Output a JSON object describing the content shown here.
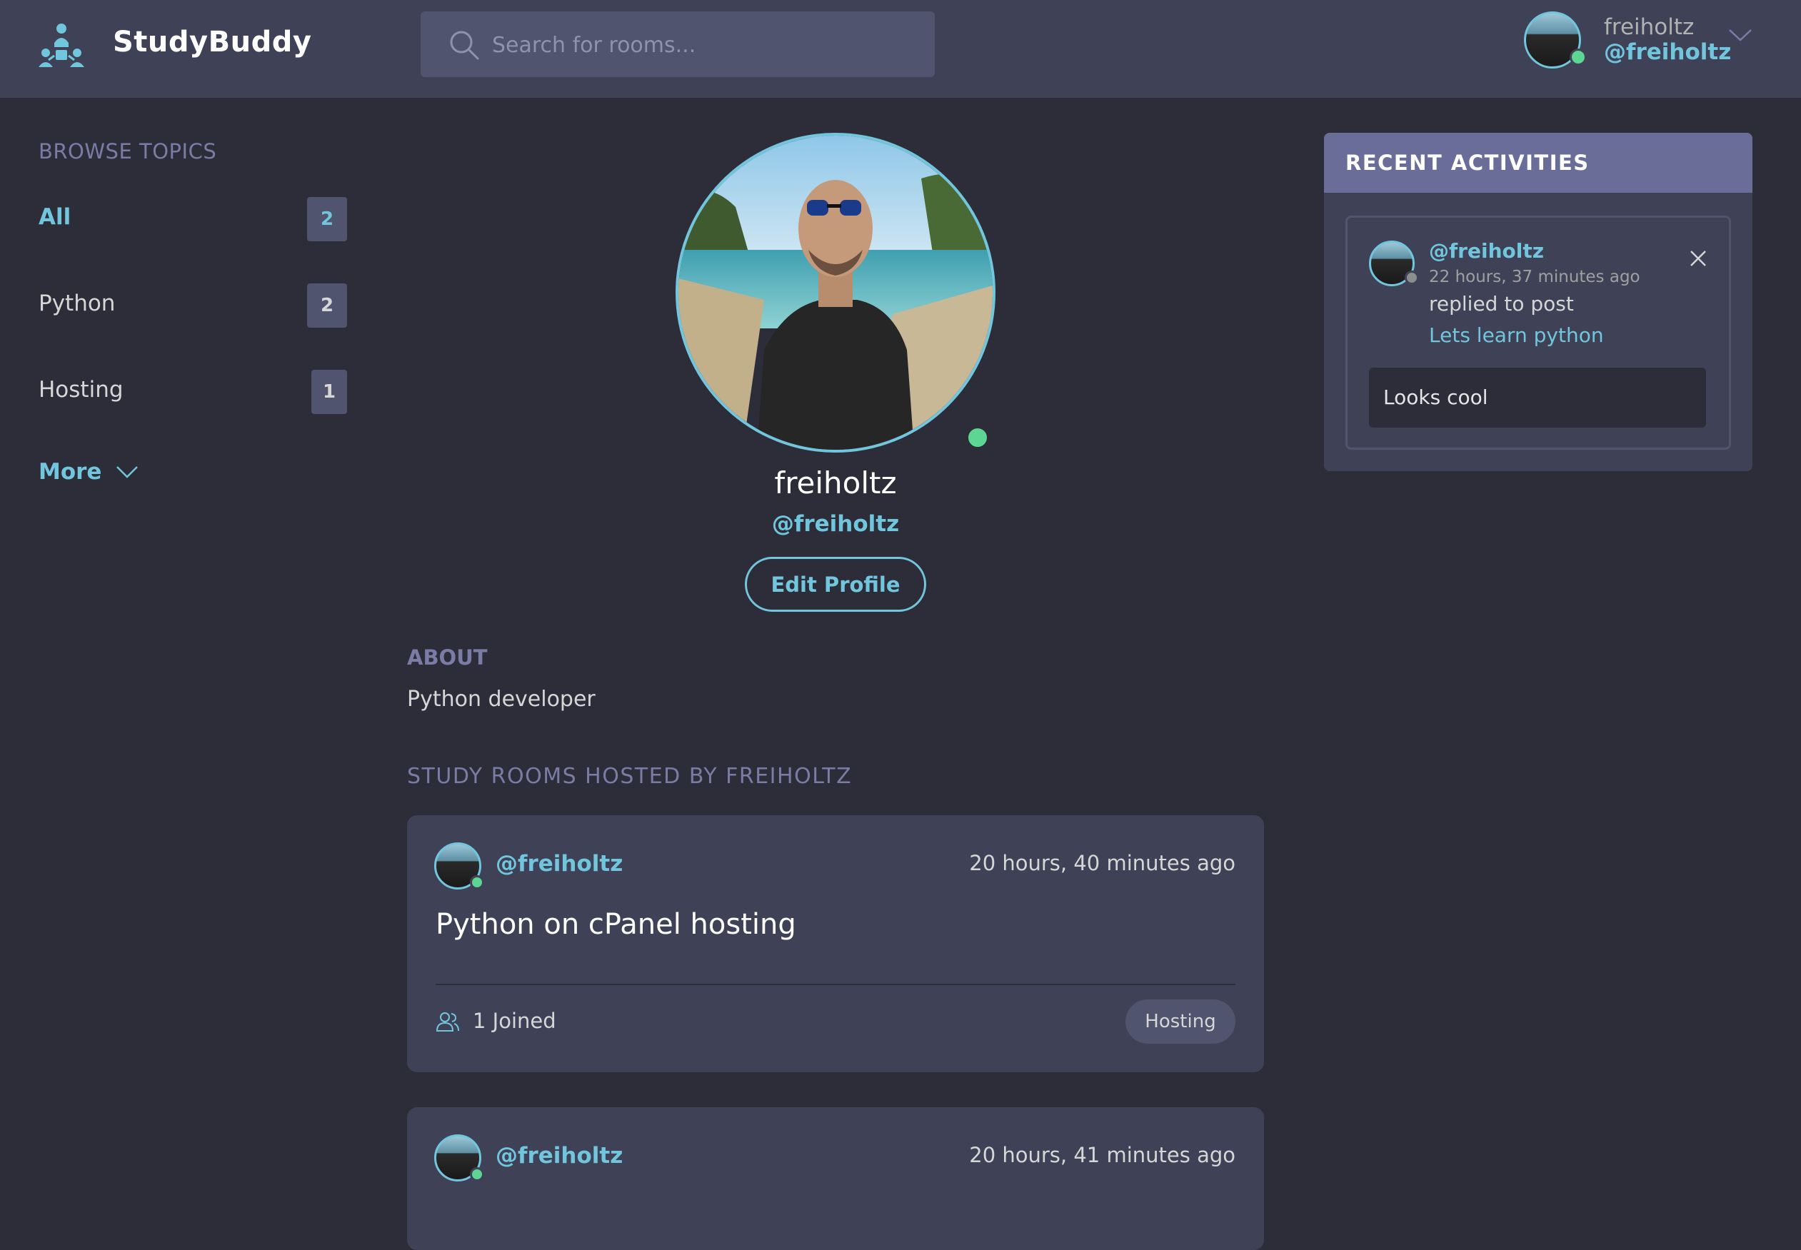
{
  "header": {
    "brand": "StudyBuddy",
    "search_placeholder": "Search for rooms...",
    "user_name": "freiholtz",
    "user_handle": "@freiholtz"
  },
  "sidebar": {
    "title": "BROWSE TOPICS",
    "topics": [
      {
        "label": "All",
        "count": "2"
      },
      {
        "label": "Python",
        "count": "2"
      },
      {
        "label": "Hosting",
        "count": "1"
      }
    ],
    "more_label": "More"
  },
  "profile": {
    "name": "freiholtz",
    "handle": "@freiholtz",
    "edit_label": "Edit Profile",
    "about_title": "ABOUT",
    "about_text": "Python developer",
    "rooms_title": "STUDY ROOMS HOSTED BY FREIHOLTZ"
  },
  "rooms": [
    {
      "host": "@freiholtz",
      "time": "20 hours, 40 minutes ago",
      "title": "Python on cPanel hosting",
      "joined": "1 Joined",
      "topic": "Hosting"
    },
    {
      "host": "@freiholtz",
      "time": "20 hours, 41 minutes ago"
    }
  ],
  "activities": {
    "title": "RECENT ACTIVITIES",
    "items": [
      {
        "handle": "@freiholtz",
        "time": "22 hours, 37 minutes ago",
        "action": "replied to post",
        "link": "Lets learn python",
        "reply": "Looks cool"
      }
    ]
  },
  "colors": {
    "background": "#2d2d39",
    "header": "#3f4156",
    "accent": "#71c6dd",
    "online": "#5dd693",
    "activities_header": "#696d97"
  }
}
